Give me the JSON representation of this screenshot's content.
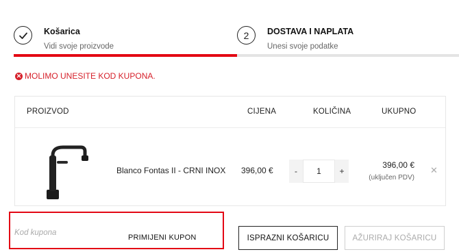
{
  "steps": [
    {
      "number": "",
      "title": "Košarica",
      "subtitle": "Vidi svoje proizvode"
    },
    {
      "number": "2",
      "title": "DOSTAVA I NAPLATA",
      "subtitle": "Unesi svoje podatke"
    }
  ],
  "progress": {
    "completed_fraction": 0.5,
    "fill_color": "#e30613",
    "track_color": "#e4e4e4"
  },
  "error": {
    "icon": "x-circle-icon",
    "text": "MOLIMO UNESITE KOD KUPONA.",
    "color": "#d6202a"
  },
  "cart": {
    "headers": {
      "product": "PROIZVOD",
      "price": "CIJENA",
      "quantity": "KOLIČINA",
      "total": "UKUPNO"
    },
    "items": [
      {
        "name": "Blanco Fontas II - CRNI INOX",
        "price": "396,00 €",
        "qty_minus": "-",
        "quantity": "1",
        "qty_plus": "+",
        "total": "396,00 €",
        "total_note": "(uključen PDV)",
        "remove": "✕"
      }
    ]
  },
  "coupon": {
    "placeholder": "Kod kupona",
    "apply_label": "PRIMIJENI KUPON",
    "highlight_color": "#e30613"
  },
  "actions": {
    "empty_cart": "ISPRAZNI KOŠARICU",
    "update_cart": "AŽURIRAJ KOŠARICU"
  }
}
